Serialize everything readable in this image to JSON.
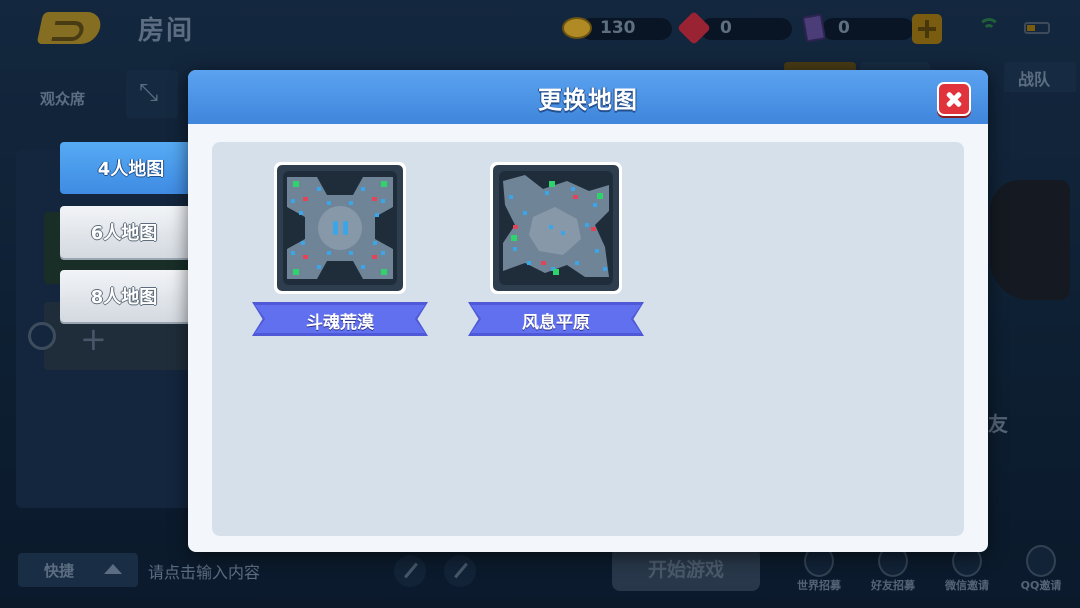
{
  "room": {
    "title": "房间",
    "resources": {
      "coins": "130",
      "gems": "0",
      "cards": "0"
    },
    "spectators_label": "观众席",
    "right_tab": "战队",
    "right_friend_text": "友",
    "quick_label": "快捷",
    "chat_placeholder": "请点击输入内容",
    "start_label": "开始游戏",
    "bottom_icons": [
      "世界招募",
      "好友招募",
      "微信邀请",
      "QQ邀请"
    ]
  },
  "modal": {
    "title": "更换地图",
    "tabs": [
      {
        "label": "4人地图",
        "active": true
      },
      {
        "label": "6人地图",
        "active": false
      },
      {
        "label": "8人地图",
        "active": false
      }
    ],
    "maps": [
      {
        "name": "斗魂荒漠"
      },
      {
        "name": "风息平原"
      }
    ]
  },
  "colors": {
    "header_blue": "#3f86dc",
    "close_red": "#e0333c",
    "ribbon_purple": "#6170ef",
    "panel_gray": "#d6e0ea"
  }
}
